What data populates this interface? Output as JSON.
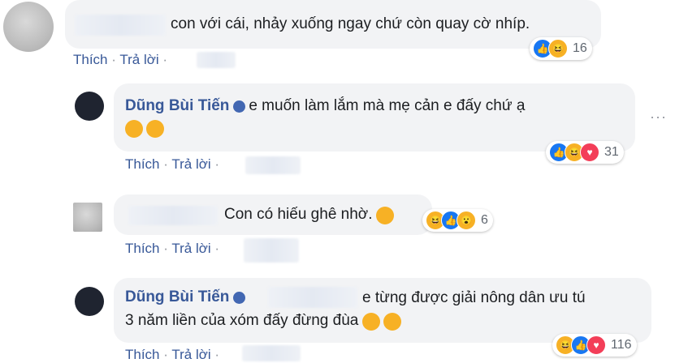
{
  "comments": [
    {
      "text": "con với cái, nhảy xuống ngay chứ còn quay cờ nhíp.",
      "actions": {
        "like": "Thích",
        "sep": "·",
        "reply": "Trả lời",
        "sep2": "·"
      },
      "reactions": {
        "icons": [
          "like-icon",
          "haha-icon"
        ],
        "count": "16"
      }
    },
    {
      "author": "Dũng Bùi Tiến",
      "verified_icon": "verified-badge-icon",
      "text_line1": "e muốn làm lắm mà mẹ cản e đấy chứ ạ",
      "emojis": [
        "laughing-emoji",
        "laughing-emoji"
      ],
      "actions": {
        "like": "Thích",
        "sep": "·",
        "reply": "Trả lời",
        "sep2": "·"
      },
      "reactions": {
        "icons": [
          "like-icon",
          "haha-icon",
          "love-icon"
        ],
        "count": "31"
      },
      "more_icon": "ellipsis-icon"
    },
    {
      "text": "Con có hiếu ghê nhờ.",
      "emojis": [
        "wink-emoji"
      ],
      "actions": {
        "like": "Thích",
        "sep": "·",
        "reply": "Trả lời",
        "sep2": "·"
      },
      "reactions": {
        "icons": [
          "haha-icon",
          "like-icon",
          "wow-icon"
        ],
        "count": "6"
      }
    },
    {
      "author": "Dũng Bùi Tiến",
      "verified_icon": "verified-badge-icon",
      "text_line1": "e từng được giải nông dân ưu tú",
      "text_line2": "3 năm liền của xóm đấy đừng đùa",
      "emojis": [
        "smile-emoji",
        "smile-emoji"
      ],
      "actions": {
        "like": "Thích",
        "sep": "·",
        "reply": "Trả lời",
        "sep2": "·"
      },
      "reactions": {
        "icons": [
          "haha-icon",
          "like-icon",
          "love-icon"
        ],
        "count": "116"
      }
    }
  ],
  "colors": {
    "name": "#385898",
    "bubble": "#f2f3f5",
    "like": "#1877f2",
    "haha": "#f7b125",
    "love": "#f33e58"
  }
}
